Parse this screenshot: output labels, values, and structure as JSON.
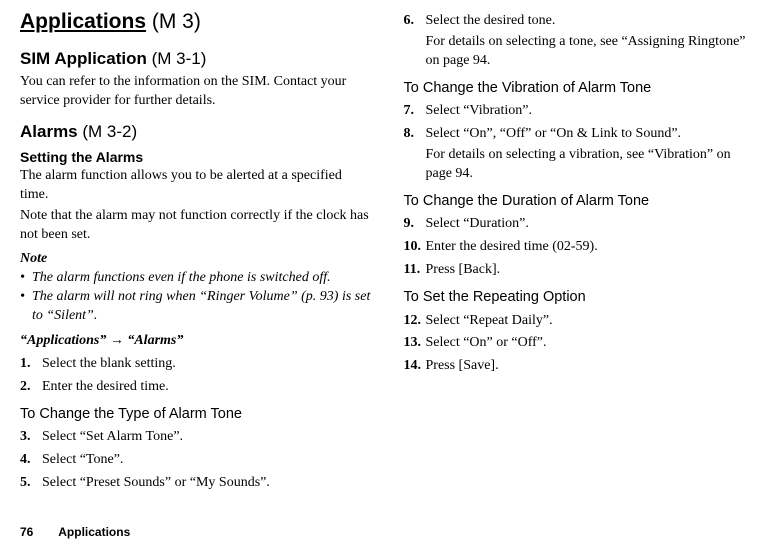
{
  "chapter": {
    "title": "Applications",
    "code": "(M 3)"
  },
  "sim": {
    "title": "SIM Application",
    "code": "(M 3-1)",
    "body": "You can refer to the information on the SIM. Contact your service provider for further details."
  },
  "alarms": {
    "title": "Alarms",
    "code": "(M 3-2)",
    "setting_title": "Setting the Alarms",
    "body1": "The alarm function allows you to be alerted at a specified time.",
    "body2": "Note that the alarm may not function correctly if the clock has not been set.",
    "note_label": "Note",
    "notes": [
      "The alarm functions even if the phone is switched off.",
      "The alarm will not ring when “Ringer Volume” (p. 93) is set to “Silent”."
    ],
    "path": "“Applications” → “Alarms”",
    "steps1": [
      {
        "n": "1.",
        "t": "Select the blank setting."
      },
      {
        "n": "2.",
        "t": "Enter the desired time."
      }
    ],
    "change_tone_title": "To Change the Type of Alarm Tone",
    "steps2": [
      {
        "n": "3.",
        "t": "Select “Set Alarm Tone”."
      },
      {
        "n": "4.",
        "t": "Select “Tone”."
      },
      {
        "n": "5.",
        "t": "Select “Preset Sounds” or “My Sounds”."
      }
    ]
  },
  "right": {
    "step6": {
      "n": "6.",
      "t": "Select the desired tone.",
      "sub": "For details on selecting a tone, see “Assigning Ringtone” on page 94."
    },
    "vib_title": "To Change the Vibration of Alarm Tone",
    "steps_vib": [
      {
        "n": "7.",
        "t": "Select “Vibration”."
      },
      {
        "n": "8.",
        "t": "Select “On”, “Off” or “On & Link to Sound”.",
        "sub": "For details on selecting a vibration, see “Vibration” on page 94."
      }
    ],
    "dur_title": "To Change the Duration of Alarm Tone",
    "steps_dur": [
      {
        "n": "9.",
        "t": "Select “Duration”."
      },
      {
        "n": "10.",
        "t": "Enter the desired time (02-59)."
      },
      {
        "n": "11.",
        "t": "Press [Back]."
      }
    ],
    "rep_title": "To Set the Repeating Option",
    "steps_rep": [
      {
        "n": "12.",
        "t": "Select “Repeat Daily”."
      },
      {
        "n": "13.",
        "t": "Select “On” or “Off”."
      },
      {
        "n": "14.",
        "t": "Press [Save]."
      }
    ]
  },
  "footer": {
    "page": "76",
    "section": "Applications"
  }
}
